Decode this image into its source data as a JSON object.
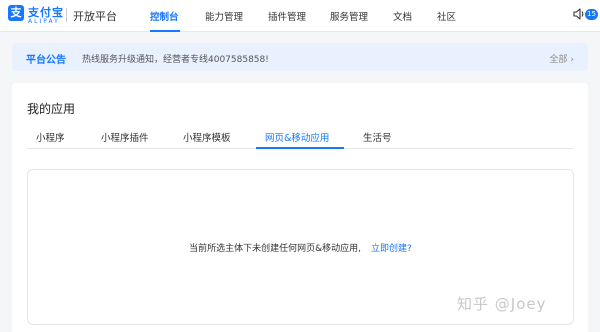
{
  "header": {
    "logo_cn": "支付宝",
    "logo_en": "ALIPAY",
    "platform": "开放平台",
    "nav": [
      {
        "label": "控制台",
        "active": true
      },
      {
        "label": "能力管理",
        "active": false
      },
      {
        "label": "插件管理",
        "active": false
      },
      {
        "label": "服务管理",
        "active": false
      },
      {
        "label": "文档",
        "active": false
      },
      {
        "label": "社区",
        "active": false
      }
    ],
    "notification_icon": "speaker-icon",
    "notification_count": "15"
  },
  "notice": {
    "title": "平台公告",
    "text": "热线服务升级通知，经营者专线4007585858!",
    "all_label": "全部",
    "all_icon": "chevron-right-icon"
  },
  "main": {
    "title": "我的应用",
    "tabs": [
      {
        "label": "小程序",
        "active": false
      },
      {
        "label": "小程序插件",
        "active": false
      },
      {
        "label": "小程序模板",
        "active": false
      },
      {
        "label": "网页&移动应用",
        "active": true
      },
      {
        "label": "生活号",
        "active": false
      }
    ],
    "empty_message": "当前所选主体下未创建任何网页&移动应用,",
    "create_link": "立即创建?"
  },
  "watermark": "知乎 @Joey",
  "colors": {
    "accent": "#1677ff",
    "notice_bg": "#e9f1fe"
  }
}
